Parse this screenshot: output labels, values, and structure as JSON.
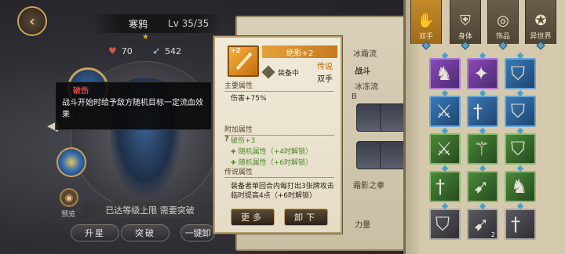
{
  "hero": {
    "name": "寒鸦",
    "level": "Lv 35/35",
    "stat_hp": "70",
    "stat_power": "542",
    "preview_label": "预览",
    "max_level_text": "已达等级上限 需要突破"
  },
  "tooltip": {
    "title": "破伤",
    "description": "战斗开始时给予敌方随机目标一定流血效果"
  },
  "bottom_buttons": [
    "升星",
    "突破",
    "一键卸"
  ],
  "card": {
    "plus": "+2",
    "item_name": "绝影+2",
    "rarity": "传说",
    "equip_status": "装备中",
    "slot": "双手",
    "main_attr_title": "主要属性",
    "main_attr": "伤害+75%",
    "extra_attr_title": "附加属性",
    "extra_attrs": [
      "破伤+3",
      "随机属性（+4时解锁）",
      "随机属性（+6时解锁）"
    ],
    "legend_title": "传说属性",
    "legend_desc": "装备者单回合内每打出3张牌攻击临时提高4点（+6时解锁）",
    "btn_more": "更多",
    "btn_unequip": "卸下"
  },
  "mid_panel": {
    "texts": [
      "冰霜流",
      "战斗",
      "B",
      "冰冻流",
      "霜影之拳",
      "力量"
    ]
  },
  "inventory": {
    "tabs": [
      {
        "label": "双手",
        "icon": "hand-icon",
        "active": true
      },
      {
        "label": "身体",
        "icon": "armor-icon",
        "active": false
      },
      {
        "label": "饰品",
        "icon": "ring-icon",
        "active": false
      },
      {
        "label": "异世界",
        "icon": "star-icon",
        "active": false
      }
    ],
    "items": [
      {
        "rarity": "purple",
        "icon": "warrior-icon"
      },
      {
        "rarity": "purple",
        "icon": "cannon-icon"
      },
      {
        "rarity": "blue",
        "icon": "shield-icon"
      },
      {
        "rarity": "blue",
        "icon": "sword-icon"
      },
      {
        "rarity": "blue",
        "icon": "dagger-icon"
      },
      {
        "rarity": "blue",
        "icon": "shield-icon"
      },
      {
        "rarity": "green",
        "icon": "sword-icon"
      },
      {
        "rarity": "green",
        "icon": "staff-icon"
      },
      {
        "rarity": "green",
        "icon": "shield-icon"
      },
      {
        "rarity": "green",
        "icon": "dagger-icon"
      },
      {
        "rarity": "green",
        "icon": "spear-icon"
      },
      {
        "rarity": "green",
        "icon": "warrior-icon"
      },
      {
        "rarity": "gray",
        "icon": "shield-icon"
      },
      {
        "rarity": "gray",
        "icon": "spear-icon",
        "count": "2"
      },
      {
        "rarity": "gray",
        "icon": "dagger-icon"
      }
    ]
  }
}
